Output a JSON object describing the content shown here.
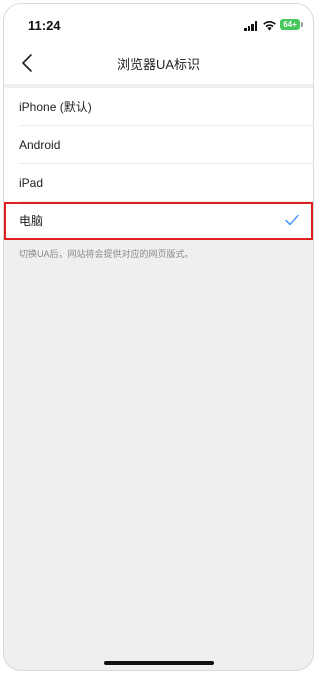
{
  "status_bar": {
    "time": "11:24",
    "battery": "64+",
    "battery_color": "#46c85b"
  },
  "nav": {
    "title": "浏览器UA标识",
    "back_icon": "chevron-left-icon"
  },
  "options": [
    {
      "label": "iPhone (默认)",
      "selected": false
    },
    {
      "label": "Android",
      "selected": false
    },
    {
      "label": "iPad",
      "selected": false
    },
    {
      "label": "电脑",
      "selected": true
    }
  ],
  "hint": "切换UA后，网站将会提供对应的网页版式。",
  "colors": {
    "accent_check": "#2f88ff",
    "highlight_border": "#e0201f",
    "background": "#efefef"
  }
}
